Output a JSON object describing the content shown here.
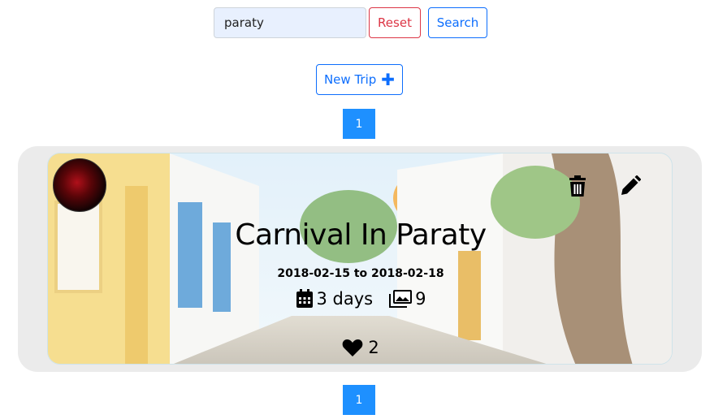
{
  "search": {
    "value": "paraty",
    "reset_label": "Reset",
    "search_label": "Search"
  },
  "new_trip": {
    "label": "New Trip"
  },
  "pagination": {
    "current_page": "1"
  },
  "trip": {
    "title": "Carnival In Paraty",
    "dates": "2018-02-15 to 2018-02-18",
    "duration": "3 days",
    "photos": "9",
    "likes": "2"
  },
  "colors": {
    "accent": "#0d6efd",
    "danger": "#dc3545",
    "page_active": "#1e90ff",
    "card_bg": "#ebebeb"
  }
}
